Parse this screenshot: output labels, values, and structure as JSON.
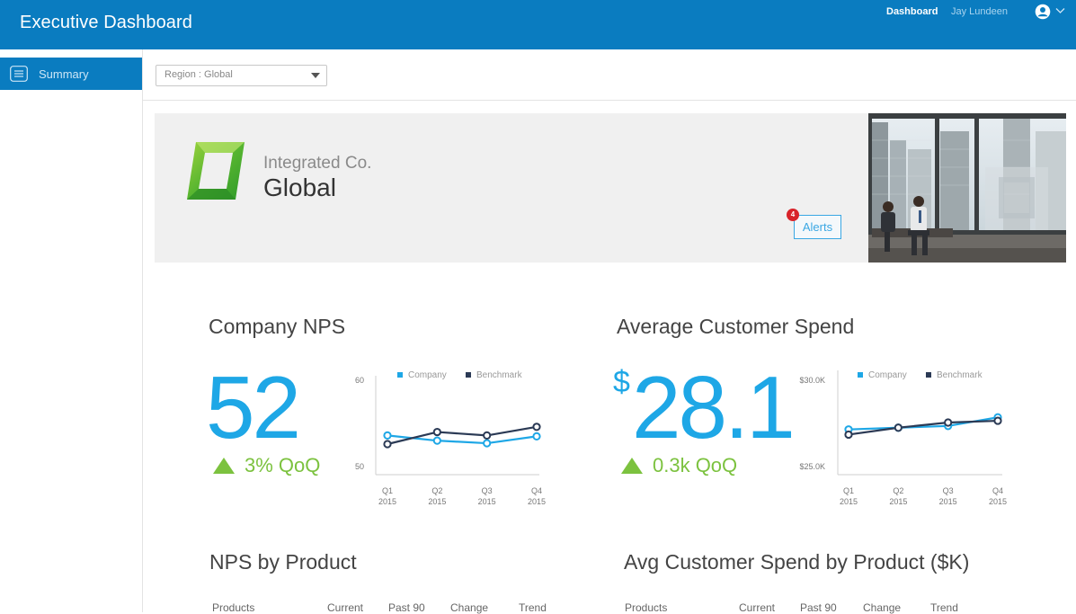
{
  "header": {
    "title": "Executive Dashboard",
    "nav_active": "Dashboard",
    "user_name": "Jay Lundeen",
    "user_icon": "user-circle-icon"
  },
  "sidebar": {
    "items": [
      {
        "label": "Summary",
        "icon": "list-icon",
        "active": true
      }
    ]
  },
  "filters": {
    "region_value": "Region : Global"
  },
  "hero": {
    "company": "Integrated Co.",
    "region": "Global",
    "alerts_label": "Alerts",
    "alerts_count": "4"
  },
  "nps": {
    "title": "Company NPS",
    "value": "52",
    "change": "3% QoQ"
  },
  "spend": {
    "title": "Average Customer Spend",
    "currency": "$",
    "value": "28.1",
    "change": "0.3k QoQ"
  },
  "nps_table": {
    "title": "NPS by Product",
    "columns": [
      "Products",
      "Current",
      "Past 90",
      "Change",
      "Trend"
    ]
  },
  "spend_table": {
    "title": "Avg Customer Spend by Product ($K)",
    "columns": [
      "Products",
      "Current",
      "Past 90",
      "Change",
      "Trend"
    ]
  },
  "colors": {
    "brand": "#0a7cc0",
    "company_series": "#1ea7e6",
    "benchmark_series": "#2b3a55",
    "positive": "#7cc23f",
    "alert": "#d8232a"
  },
  "chart_data": [
    {
      "type": "line",
      "categories": [
        "Q1\n2015",
        "Q2\n2015",
        "Q3\n2015",
        "Q4\n2015"
      ],
      "y_tick_labels": [
        "60",
        "50"
      ],
      "ylim": [
        50,
        60
      ],
      "series": [
        {
          "name": "Company",
          "values": [
            53.5,
            52.9,
            52.6,
            53.4
          ]
        },
        {
          "name": "Benchmark",
          "values": [
            52.5,
            53.9,
            53.5,
            54.5
          ]
        }
      ],
      "legend": "top",
      "grid": false
    },
    {
      "type": "line",
      "categories": [
        "Q1\n2015",
        "Q2\n2015",
        "Q3\n2015",
        "Q4\n2015"
      ],
      "y_tick_labels": [
        "$30.0K",
        "$25.0K"
      ],
      "ylim": [
        25,
        30
      ],
      "series": [
        {
          "name": "Company",
          "values": [
            27.1,
            27.2,
            27.3,
            27.8
          ]
        },
        {
          "name": "Benchmark",
          "values": [
            26.8,
            27.2,
            27.5,
            27.6
          ]
        }
      ],
      "legend": "top",
      "grid": false
    }
  ]
}
